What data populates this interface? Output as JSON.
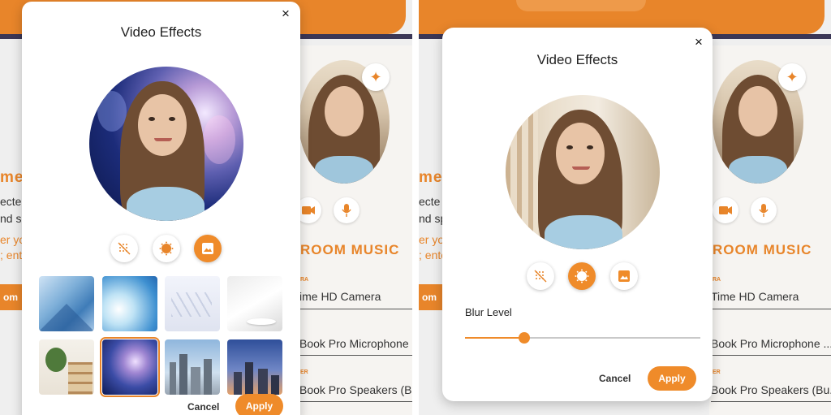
{
  "left_panel": {
    "modal": {
      "title": "Video Effects",
      "close_glyph": "×",
      "active_effect": "background",
      "effects": [
        {
          "name": "no-effect",
          "icon": "no-effect-icon"
        },
        {
          "name": "blur",
          "icon": "blur-icon"
        },
        {
          "name": "background",
          "icon": "image-icon"
        }
      ],
      "backgrounds": [
        {
          "name": "blue-abstract-polygons"
        },
        {
          "name": "blue-gradient-waves"
        },
        {
          "name": "white-hexagons"
        },
        {
          "name": "white-curves-podium"
        },
        {
          "name": "plant-bookshelf"
        },
        {
          "name": "galaxy"
        },
        {
          "name": "city-skyline-day"
        },
        {
          "name": "city-skyline-dusk"
        }
      ],
      "selected_background": "galaxy",
      "cancel_label": "Cancel",
      "apply_label": "Apply"
    },
    "background_page": {
      "heading_fragment": "me",
      "text_fragment_1": "ecte",
      "text_fragment_2": "nd s",
      "orange_fragment_1": "er yo",
      "orange_fragment_2": "; ent",
      "button_fragment": "om",
      "section_title": "ROOM MUSIC",
      "device_label_1": "RA",
      "device_1": "ime HD Camera",
      "device_2": "Book Pro Microphone ...",
      "device_label_3": "ER",
      "device_3": "Book Pro Speakers (Bu..."
    }
  },
  "right_panel": {
    "modal": {
      "title": "Video Effects",
      "close_glyph": "×",
      "active_effect": "blur",
      "blur_label": "Blur Level",
      "blur_level": 0.25,
      "cancel_label": "Cancel",
      "apply_label": "Apply"
    },
    "background_page": {
      "heading_fragment": "me",
      "text_fragment_1": "ecte",
      "text_fragment_2": "nd sp",
      "orange_fragment_1": "er yo",
      "orange_fragment_2": "; ente",
      "button_fragment": "om",
      "section_title": "ROOM MUSIC",
      "device_label_1": "RA",
      "device_1": "Time HD Camera",
      "device_2": "Book Pro Microphone ...",
      "device_label_3": "ER",
      "device_3": "Book Pro Speakers (Bu..."
    }
  },
  "colors": {
    "accent": "#ef8b2a",
    "page_bg": "#efefef",
    "header_dark": "#3b3756"
  }
}
